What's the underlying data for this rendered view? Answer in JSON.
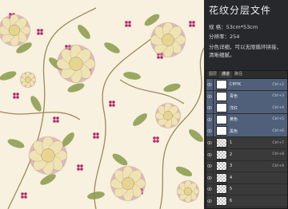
{
  "app": {
    "title": "花纹分层文件",
    "meta_lines": [
      "规  格：53cm*53cm",
      "分辨率：254",
      "分色详细，可以无限循环拼接，",
      "清晰细腻。"
    ]
  },
  "layers_panel": {
    "tabs": [
      "图层",
      "通道",
      "路径"
    ],
    "active_tab": "通道",
    "rows": [
      {
        "name": "CMYK",
        "shortcut": "Ctrl+2",
        "selected": true,
        "thumb": "white"
      },
      {
        "name": "青色",
        "shortcut": "Ctrl+3",
        "selected": true,
        "thumb": "white"
      },
      {
        "name": "洋红",
        "shortcut": "Ctrl+4",
        "selected": true,
        "thumb": "white"
      },
      {
        "name": "黄色",
        "shortcut": "Ctrl+5",
        "selected": true,
        "thumb": "white"
      },
      {
        "name": "黑色",
        "shortcut": "Ctrl+6",
        "selected": true,
        "thumb": "white"
      },
      {
        "name": "1",
        "shortcut": "Ctrl+7",
        "selected": false,
        "thumb": "check"
      },
      {
        "name": "2",
        "shortcut": "Ctrl+8",
        "selected": false,
        "thumb": "check"
      },
      {
        "name": "3",
        "shortcut": "Ctrl+9",
        "selected": false,
        "thumb": "check"
      },
      {
        "name": "4",
        "shortcut": "",
        "selected": false,
        "thumb": "check"
      },
      {
        "name": "5",
        "shortcut": "",
        "selected": false,
        "thumb": "check"
      },
      {
        "name": "6",
        "shortcut": "",
        "selected": false,
        "thumb": "check"
      }
    ]
  },
  "colors": {
    "canvas_bg": "#f8f1df",
    "panel_bg": "#3a3a3a",
    "selection": "#50607a",
    "peony_cream": "#efe3b6",
    "peony_pink": "#c88ba4",
    "leaf_green": "#8a9a4a",
    "berry_magenta": "#b0286a"
  }
}
